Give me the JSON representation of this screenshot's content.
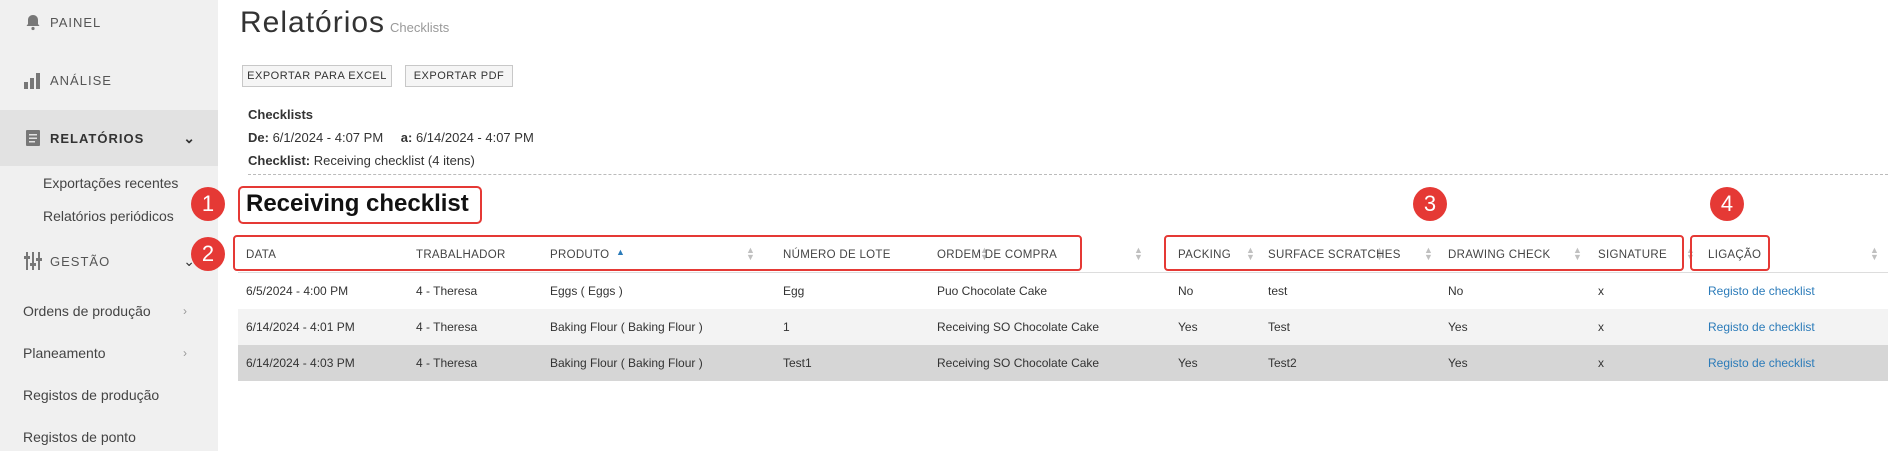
{
  "sidebar": {
    "items": [
      {
        "label": "PAINEL"
      },
      {
        "label": "ANÁLISE"
      },
      {
        "label": "RELATÓRIOS"
      },
      {
        "label": "GESTÃO"
      }
    ],
    "sub_items": [
      "Exportações recentes",
      "Relatórios periódicos"
    ],
    "flat_items": [
      "Ordens de produção",
      "Planeamento",
      "Registos de produção",
      "Registos de ponto"
    ]
  },
  "page": {
    "title": "Relatórios",
    "subtitle": "Checklists"
  },
  "toolbar": {
    "export_excel": "EXPORTAR PARA EXCEL",
    "export_pdf": "EXPORTAR PDF"
  },
  "info": {
    "heading": "Checklists",
    "from_label": "De:",
    "from_value": "6/1/2024 - 4:07 PM",
    "to_label": "a:",
    "to_value": "6/14/2024 - 4:07 PM",
    "checklist_label": "Checklist:",
    "checklist_value": "Receiving checklist (4 itens)"
  },
  "section": {
    "title": "Receiving checklist"
  },
  "annotations": [
    "1",
    "2",
    "3",
    "4"
  ],
  "table": {
    "columns": [
      "DATA",
      "TRABALHADOR",
      "PRODUTO",
      "NÚMERO DE LOTE",
      "ORDEM DE COMPRA",
      "PACKING",
      "SURFACE SCRATCHES",
      "DRAWING CHECK",
      "SIGNATURE",
      "LIGAÇÃO"
    ],
    "rows": [
      [
        "6/5/2024 - 4:00 PM",
        "4 - Theresa",
        "Eggs ( Eggs )",
        "Egg",
        "Puo Chocolate Cake",
        "No",
        "test",
        "No",
        "x",
        "Registo de checklist"
      ],
      [
        "6/14/2024 - 4:01 PM",
        "4 - Theresa",
        "Baking Flour ( Baking Flour )",
        "1",
        "Receiving SO Chocolate Cake",
        "Yes",
        "Test",
        "Yes",
        "x",
        "Registo de checklist"
      ],
      [
        "6/14/2024 - 4:03 PM",
        "4 - Theresa",
        "Baking Flour ( Baking Flour )",
        "Test1",
        "Receiving SO Chocolate Cake",
        "Yes",
        "Test2",
        "Yes",
        "x",
        "Registo de checklist"
      ]
    ]
  },
  "colors": {
    "accent": "#e53935",
    "link": "#2b7bb9",
    "sidebar_bg": "#f0f0f0"
  }
}
